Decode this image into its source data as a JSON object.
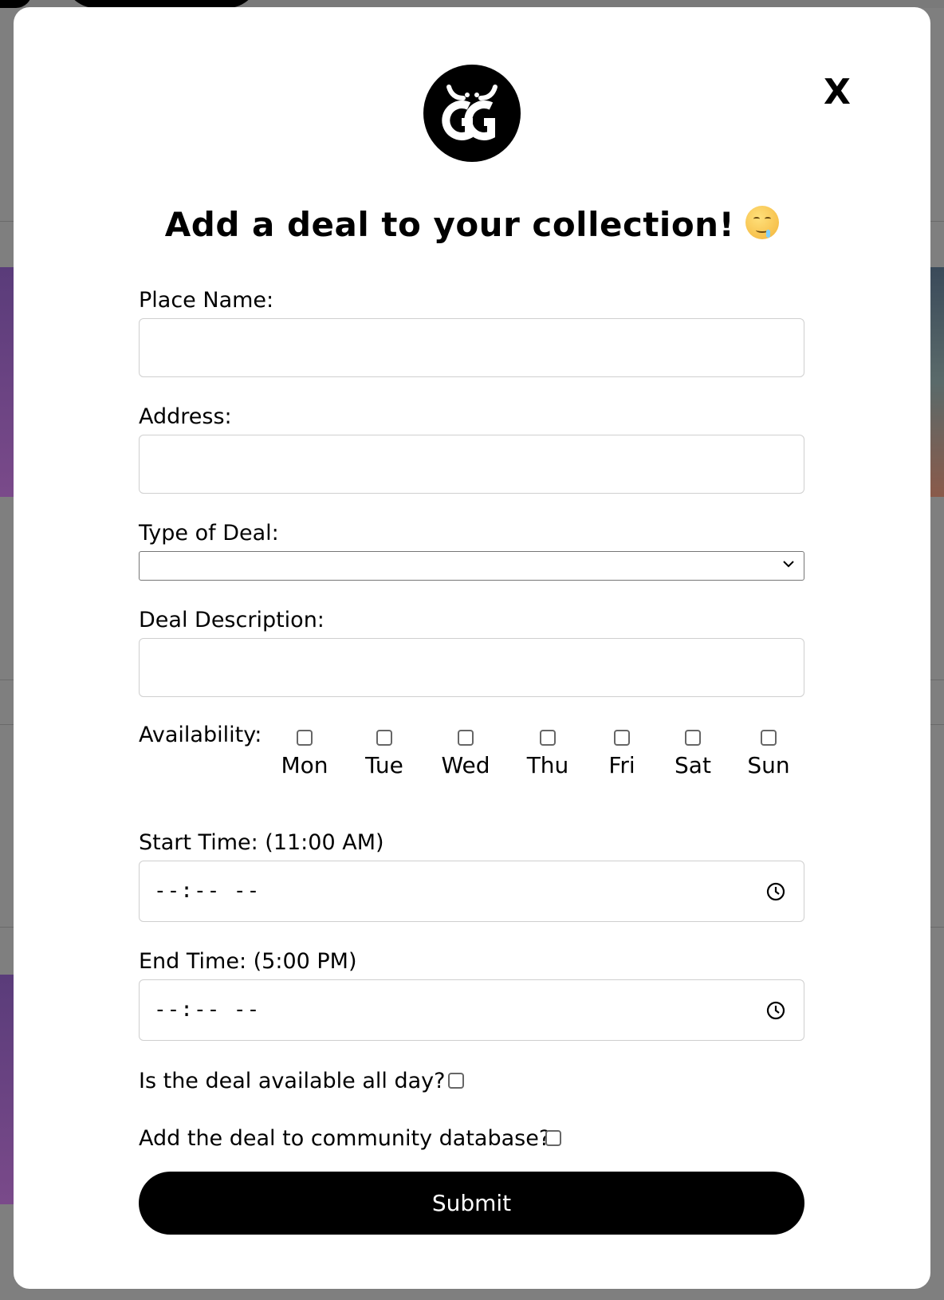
{
  "modal": {
    "title": "Add a deal to your collection!",
    "close_label": "X",
    "logo_icon": "gg-bull-logo-icon"
  },
  "form": {
    "place_name": {
      "label": "Place Name:",
      "value": ""
    },
    "address": {
      "label": "Address:",
      "value": ""
    },
    "deal_type": {
      "label": "Type of Deal:",
      "selected": ""
    },
    "deal_description": {
      "label": "Deal Description:",
      "value": ""
    },
    "availability": {
      "label": "Availability:",
      "days": [
        "Mon",
        "Tue",
        "Wed",
        "Thu",
        "Fri",
        "Sat",
        "Sun"
      ]
    },
    "start_time": {
      "label": "Start Time: (11:00 AM)",
      "value": "--:-- --"
    },
    "end_time": {
      "label": "End Time: (5:00 PM)",
      "value": "--:-- --"
    },
    "all_day": {
      "label": "Is the deal available all day?",
      "checked": false
    },
    "community": {
      "label": "Add the deal to community database?",
      "checked": false
    },
    "submit_label": "Submit"
  },
  "colors": {
    "accent": "#000000",
    "border": "#cfcfcf",
    "backdrop": "#7f7f7f"
  }
}
